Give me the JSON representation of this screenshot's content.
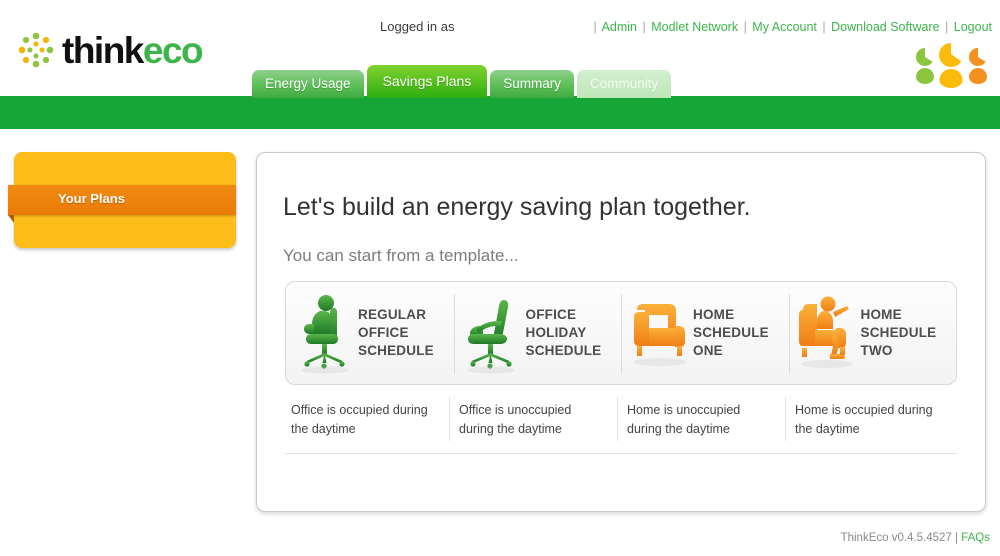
{
  "header": {
    "logo_think": "think",
    "logo_eco": "eco",
    "logo_mark_icon": "starburst-dots-icon",
    "logged_in_as": "Logged in as",
    "people_icon": "three-people-icon",
    "top_links": [
      {
        "label": "Admin"
      },
      {
        "label": "Modlet Network"
      },
      {
        "label": "My Account"
      },
      {
        "label": "Download Software"
      },
      {
        "label": "Logout"
      }
    ],
    "separator": "|"
  },
  "tabs": [
    {
      "label": "Energy Usage",
      "state": "normal"
    },
    {
      "label": "Savings Plans",
      "state": "active"
    },
    {
      "label": "Summary",
      "state": "normal"
    },
    {
      "label": "Community",
      "state": "muted"
    }
  ],
  "sidebar": {
    "ribbon_label": "Your Plans"
  },
  "main": {
    "heading": "Let's build an energy saving plan together.",
    "subheading": "You can start from a template...",
    "templates": [
      {
        "label": "REGULAR\nOFFICE\nSCHEDULE",
        "caption": "Office is occupied during the daytime",
        "icon": "person-in-office-chair-icon",
        "color": "#2f9b3c"
      },
      {
        "label": "OFFICE\nHOLIDAY\nSCHEDULE",
        "caption": "Office is unoccupied during the daytime",
        "icon": "empty-office-chair-icon",
        "color": "#2f9b3c"
      },
      {
        "label": "HOME\nSCHEDULE\nONE",
        "caption": "Home is unoccupied during the daytime",
        "icon": "empty-armchair-icon",
        "color": "#f6911e"
      },
      {
        "label": "HOME\nSCHEDULE\nTWO",
        "caption": "Home is occupied during the daytime",
        "icon": "person-in-armchair-icon",
        "color": "#f6911e"
      }
    ]
  },
  "footer": {
    "version": "ThinkEco v0.4.5.4527",
    "separator": "|",
    "faqs_label": "FAQs"
  },
  "colors": {
    "brand_green": "#3cb54a",
    "band_green": "#16a637",
    "accent_yellow": "#fcbd1a",
    "accent_orange": "#ea7a07"
  }
}
